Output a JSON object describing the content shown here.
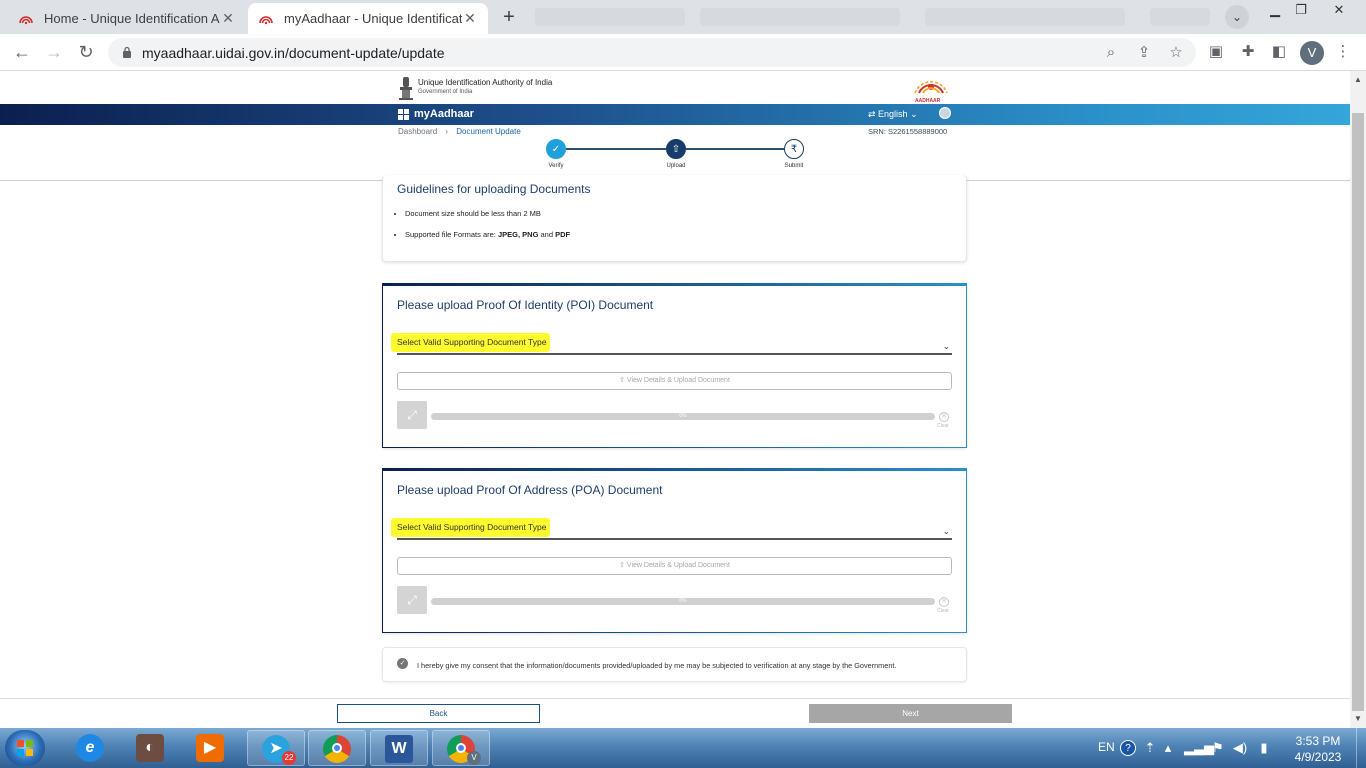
{
  "browser": {
    "tabs": [
      {
        "title": "Home - Unique Identification Au",
        "active": false
      },
      {
        "title": "myAadhaar - Unique Identificatio",
        "active": true
      }
    ],
    "url": "myaadhaar.uidai.gov.in/document-update/update",
    "profile_initial": "V"
  },
  "header": {
    "gov_title": "Unique Identification Authority of India",
    "gov_subtitle": "Government of India",
    "logo_text": "AADHAAR",
    "brand": "myAadhaar",
    "language": "English"
  },
  "breadcrumb": {
    "home": "Dashboard",
    "separator": "›",
    "current": "Document Update"
  },
  "srn": "SRN: S2261558889000",
  "stepper": {
    "steps": [
      {
        "label": "Verify",
        "status": "done"
      },
      {
        "label": "Upload",
        "status": "current"
      },
      {
        "label": "Submit",
        "status": "pending"
      }
    ]
  },
  "guidelines": {
    "title": "Guidelines for uploading Documents",
    "item1": "Document size should be less than 2 MB",
    "item2_prefix": "Supported file Formats are: ",
    "item2_formats": "JPEG, PNG",
    "item2_and": " and ",
    "item2_last": "PDF"
  },
  "poi": {
    "title": "Please upload Proof Of Identity (POI) Document",
    "select_placeholder": "Select Valid Supporting Document Type",
    "upload_label": "View Details & Upload Document",
    "progress": "0%",
    "clear_label": "Clear"
  },
  "poa": {
    "title": "Please upload Proof Of Address (POA) Document",
    "select_placeholder": "Select Valid Supporting Document Type",
    "upload_label": "View Details & Upload Document",
    "progress": "0%",
    "clear_label": "Clear"
  },
  "consent": {
    "text": "I hereby give my consent that the information/documents provided/uploaded by me may be subjected to verification at any stage by the Government."
  },
  "actions": {
    "back": "Back",
    "next": "Next"
  },
  "taskbar": {
    "telegram_badge": "22",
    "chrome_profile": "V",
    "language": "EN",
    "time": "3:53 PM",
    "date": "4/9/2023"
  },
  "colors": {
    "accent_blue": "#1a66a8",
    "highlight": "#fdfb2e",
    "next_disabled": "#a6a6a6"
  }
}
